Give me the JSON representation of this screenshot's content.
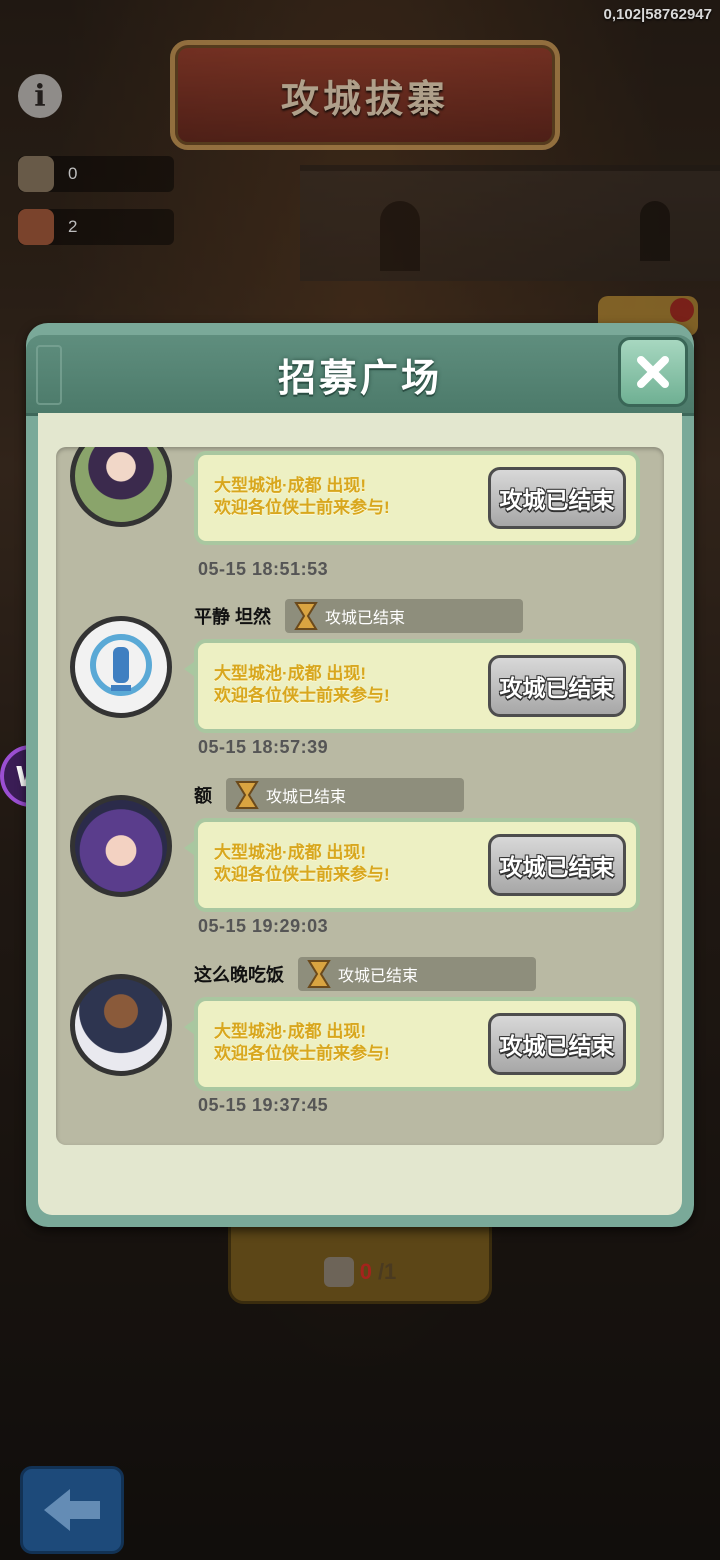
{
  "top_id": "0,102|58762947",
  "banner_title": "攻城拔寨",
  "resources": [
    {
      "icon": "crate-icon",
      "value": "0"
    },
    {
      "icon": "scroll-icon",
      "value": "2"
    }
  ],
  "floating_badge": "W",
  "modal": {
    "title": "招募广场",
    "entries": [
      {
        "username": "",
        "status": "",
        "message": "大型城池·成都 出现!\n欢迎各位侠士前来参与!",
        "button": "攻城已结束",
        "time": "05-15 18:51:53"
      },
      {
        "username": "平静 坦然",
        "status": "攻城已结束",
        "message": "大型城池·成都 出现!\n欢迎各位侠士前来参与!",
        "button": "攻城已结束",
        "time": "05-15 18:57:39"
      },
      {
        "username": "额",
        "status": "攻城已结束",
        "message": "大型城池·成都 出现!\n欢迎各位侠士前来参与!",
        "button": "攻城已结束",
        "time": "05-15 19:29:03"
      },
      {
        "username": "这么晚吃饭",
        "status": "攻城已结束",
        "message": "大型城池·成都 出现!\n欢迎各位侠士前来参与!",
        "button": "攻城已结束",
        "time": "05-15 19:37:45"
      }
    ]
  },
  "march": {
    "count_current": "0",
    "count_total": "/1"
  },
  "colors": {
    "modal_header": "#5f8e7e",
    "bubble_text": "#d8a71e",
    "panel": "#b9b9a3"
  }
}
